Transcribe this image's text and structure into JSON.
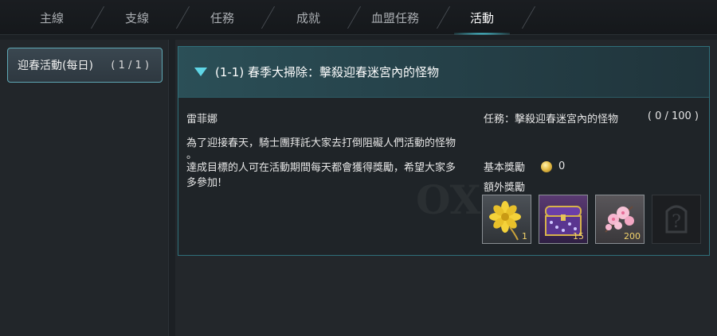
{
  "tabs": [
    {
      "label": "主線",
      "active": false
    },
    {
      "label": "支線",
      "active": false
    },
    {
      "label": "任務",
      "active": false
    },
    {
      "label": "成就",
      "active": false
    },
    {
      "label": "血盟任務",
      "active": false
    },
    {
      "label": "活動",
      "active": true
    }
  ],
  "sidebar": {
    "category": {
      "label": "迎春活動(每日)",
      "count": "( 1 / 1 )"
    }
  },
  "quest": {
    "title": "(1-1) 春季大掃除：擊殺迎春迷宮內的怪物",
    "npc": "雷菲娜",
    "description_line1": "為了迎接春天，騎士團拜託大家去打倒阻礙人們活動的怪物",
    "description_line2": "。",
    "description_line3": "達成目標的人可在活動期間每天都會獲得獎勵，希望大家多多參加!",
    "task_label": "任務：擊殺迎春迷宮內的怪物",
    "task_progress": "( 0 / 100 )",
    "basic_reward_label": "基本獎勵",
    "basic_reward_value": "0",
    "extra_reward_label": "額外獎勵",
    "reward_items": [
      {
        "icon": "yellow-flower-icon",
        "qty": "1"
      },
      {
        "icon": "purple-treasure-chest-icon",
        "qty": "15"
      },
      {
        "icon": "pink-blossom-icon",
        "qty": "200"
      },
      {
        "icon": "locked-mystery-icon",
        "qty": ""
      }
    ]
  },
  "colors": {
    "accent": "#5fd6e6",
    "quantity": "#f2d36b"
  }
}
